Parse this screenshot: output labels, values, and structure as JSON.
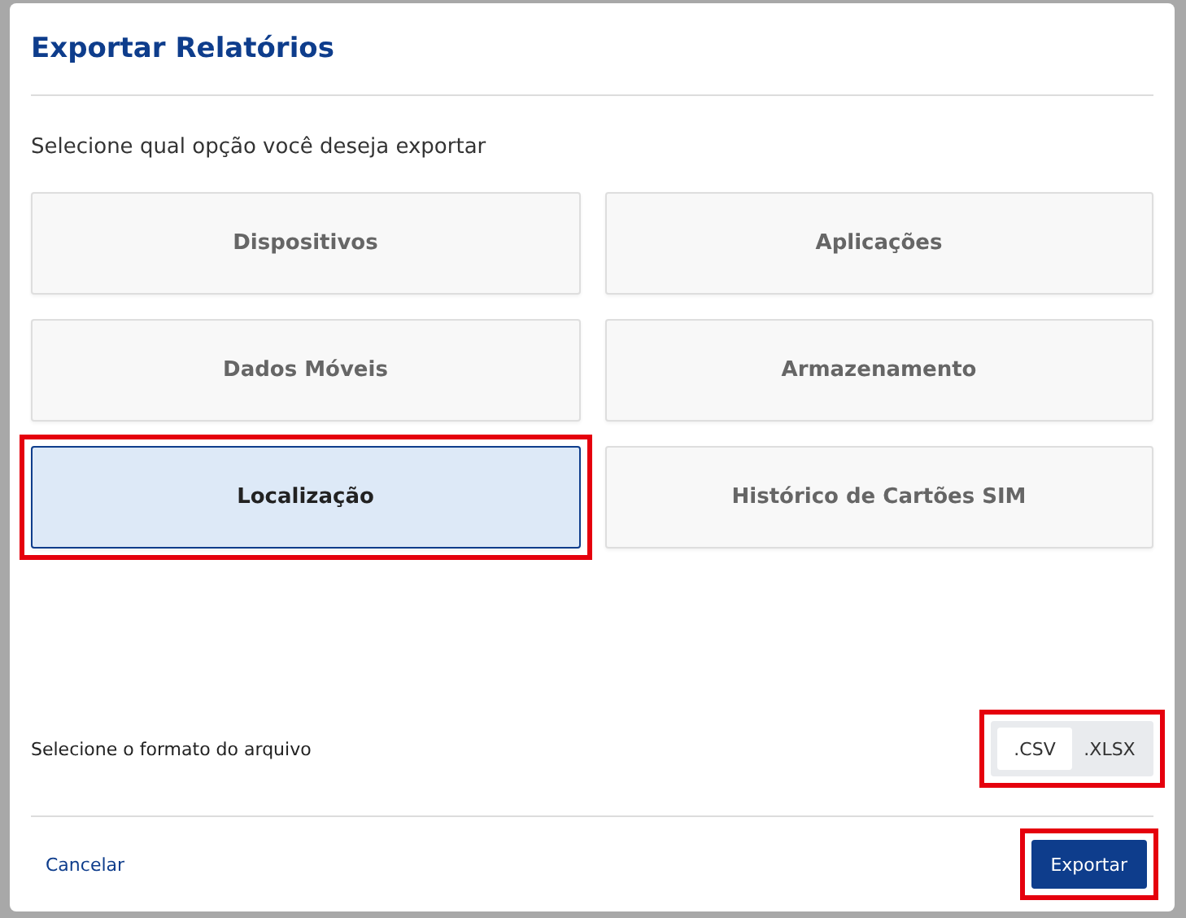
{
  "dialog": {
    "title": "Exportar Relatórios",
    "prompt": "Selecione qual opção você deseja exportar",
    "options": [
      {
        "label": "Dispositivos",
        "selected": false,
        "highlighted": false
      },
      {
        "label": "Aplicações",
        "selected": false,
        "highlighted": false
      },
      {
        "label": "Dados Móveis",
        "selected": false,
        "highlighted": false
      },
      {
        "label": "Armazenamento",
        "selected": false,
        "highlighted": false
      },
      {
        "label": "Localização",
        "selected": true,
        "highlighted": true
      },
      {
        "label": "Histórico de Cartões SIM",
        "selected": false,
        "highlighted": false
      }
    ],
    "format": {
      "label": "Selecione o formato do arquivo",
      "highlighted": true,
      "options": [
        {
          "label": ".CSV",
          "selected": true
        },
        {
          "label": ".XLSX",
          "selected": false
        }
      ]
    },
    "cancel": "Cancelar",
    "export": {
      "label": "Exportar",
      "highlighted": true
    }
  }
}
